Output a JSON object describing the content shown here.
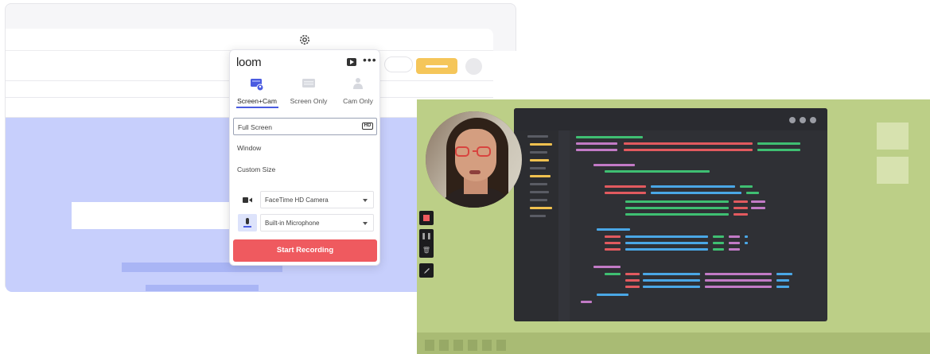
{
  "icons": {
    "settings": "gear-icon",
    "record_video": "video-icon",
    "more": "more-icon",
    "camera": "camera-icon",
    "microphone": "microphone-icon",
    "stop": "stop-icon",
    "pause": "pause-icon",
    "delete": "trash-icon",
    "draw": "pen-icon"
  },
  "loom": {
    "logo": "loom",
    "more_label": "•••",
    "modes": [
      {
        "label": "Screen+Cam",
        "active": true
      },
      {
        "label": "Screen Only",
        "active": false
      },
      {
        "label": "Cam Only",
        "active": false
      }
    ],
    "options": [
      {
        "label": "Full Screen",
        "badge": "HD",
        "selected": true
      },
      {
        "label": "Window",
        "selected": false
      },
      {
        "label": "Custom Size",
        "selected": false
      }
    ],
    "camera_select": "FaceTime HD Camera",
    "microphone_select": "Built-in Microphone",
    "start_button": "Start Recording"
  },
  "colors": {
    "accent": "#4a5be0",
    "start_button": "#ef5a5f",
    "background_green": "#bccf87",
    "page_blue": "#c7cffc",
    "cta_yellow": "#f5c65a",
    "editor_bg": "#2f3035"
  }
}
